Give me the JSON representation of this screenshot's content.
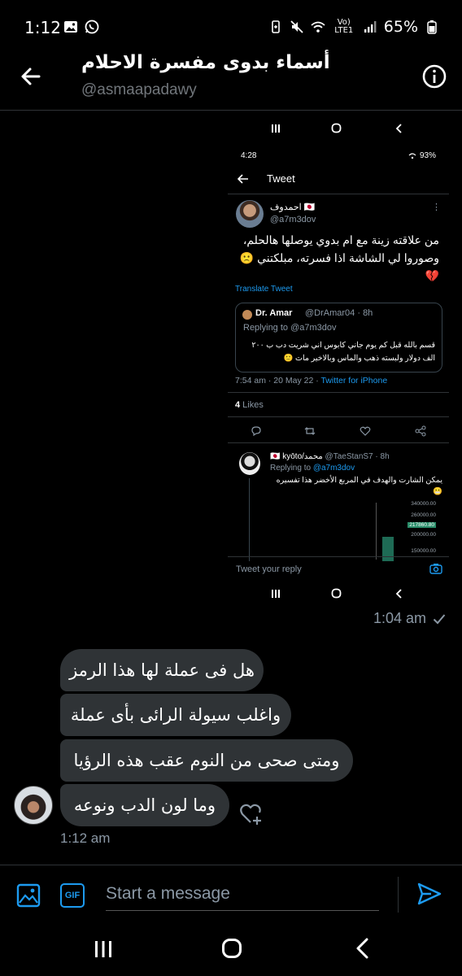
{
  "status_bar": {
    "time": "1:12",
    "battery": "65%",
    "network": "Vo) LTE1"
  },
  "header": {
    "title": "أسماء بدوى مفسرة الاحلام",
    "handle": "@asmaapadawy"
  },
  "attached_screenshot": {
    "status_time": "4:28",
    "status_battery": "93%",
    "page_title": "Tweet",
    "author_name": "احمدوف 🇯🇵",
    "author_handle": "@a7m3dov",
    "tweet_text_line1": "من علاقته زينة مع ام بدوي يوصلها هالحلم،",
    "tweet_text_line2": "وصوروا لي الشاشة اذا فسرته، مبلكتني 🙁",
    "tweet_text_line3": "💔",
    "translate": "Translate Tweet",
    "quote": {
      "name": "Dr. Amar",
      "handle_time": "@DrAmar04 · 8h",
      "replying": "Replying to @a7m3dov",
      "text_line1": "قسم بالله قبل كم يوم جاني كابوس اني شريت دب ب ٢٠٠",
      "text_line2": "الف دولار ولبسته ذهب والماس وبالاخير مات 🙂"
    },
    "meta_time": "7:54 am · 20 May 22 · ",
    "meta_source": "Twitter for iPhone",
    "likes_count": "4",
    "likes_label": " Likes",
    "reply": {
      "name": "🇯🇵 kyōto/محمد",
      "handle_time": " @TaeStanS7 · 8h",
      "replying_prefix": "Replying to ",
      "replying_mention": "@a7m3dov",
      "text_line1": "يمكن الشارت والهدف في المربع الأخضر هذا تفسيره",
      "text_line2": "😬",
      "chart_labels": [
        "340000.00",
        "260000.00",
        "217860.80",
        "200000.00",
        "150000.00"
      ]
    },
    "reply_placeholder": "Tweet your reply"
  },
  "sent_time": "1:04 am",
  "messages": [
    {
      "text": "هل فى عملة لها هذا الرمز"
    },
    {
      "text": "واغلب سيولة الرائى بأى عملة"
    },
    {
      "text": "ومتى صحى من النوم عقب هذه الرؤيا"
    },
    {
      "text": "وما لون الدب ونوعه"
    }
  ],
  "received_time": "1:12 am",
  "compose": {
    "placeholder": "Start a message",
    "gif_label": "GIF"
  },
  "colors": {
    "accent": "#1d9bf0",
    "bubble": "#2f3336",
    "background": "#000000",
    "muted": "#8b98a5"
  },
  "icons": [
    "image-icon",
    "whatsapp-icon",
    "battery-saver-icon",
    "mute-icon",
    "wifi-icon",
    "signal-icon",
    "battery-icon",
    "back-arrow-icon",
    "info-icon",
    "check-icon",
    "add-reaction-icon",
    "image-attach-icon",
    "gif-icon",
    "send-icon",
    "recents-icon",
    "home-icon",
    "nav-back-icon"
  ]
}
